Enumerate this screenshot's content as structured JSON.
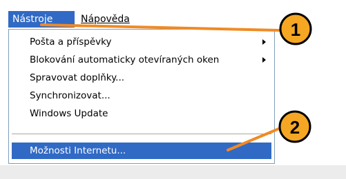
{
  "menubar": {
    "items": [
      {
        "label": "Nástroje",
        "active": true
      },
      {
        "label": "Nápověda",
        "active": false
      }
    ]
  },
  "menu": {
    "items": [
      {
        "label": "Pošta a příspěvky",
        "has_submenu": true
      },
      {
        "label": "Blokování automaticky otevíraných oken",
        "has_submenu": true
      },
      {
        "label": "Spravovat doplňky...",
        "has_submenu": false
      },
      {
        "label": "Synchronizovat...",
        "has_submenu": false
      },
      {
        "label": "Windows Update",
        "has_submenu": false
      },
      {
        "label": "Možnosti Internetu...",
        "has_submenu": false,
        "highlighted": true
      }
    ]
  },
  "callouts": [
    {
      "number": "1"
    },
    {
      "number": "2"
    }
  ],
  "colors": {
    "highlight": "#316ac5",
    "callout_fill": "#f5a623",
    "callout_line": "#f08a24"
  }
}
